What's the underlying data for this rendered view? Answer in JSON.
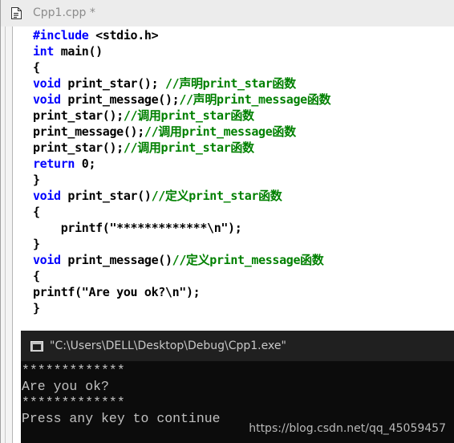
{
  "editor": {
    "tab_title": "Cpp1.cpp *",
    "icon": "cpp-file-icon",
    "lines": [
      {
        "segments": [
          {
            "text": "#include",
            "kind": "kw"
          },
          {
            "text": " <stdio.h>",
            "kind": "tx"
          }
        ]
      },
      {
        "segments": [
          {
            "text": "int",
            "kind": "kw"
          },
          {
            "text": " main()",
            "kind": "tx"
          }
        ]
      },
      {
        "segments": [
          {
            "text": "{",
            "kind": "tx"
          }
        ]
      },
      {
        "segments": [
          {
            "text": "void",
            "kind": "kw"
          },
          {
            "text": " print_star(); ",
            "kind": "tx"
          },
          {
            "text": "//声明print_star函数",
            "kind": "cm"
          }
        ]
      },
      {
        "segments": [
          {
            "text": "void",
            "kind": "kw"
          },
          {
            "text": " print_message();",
            "kind": "tx"
          },
          {
            "text": "//声明print_message函数",
            "kind": "cm"
          }
        ]
      },
      {
        "segments": [
          {
            "text": "print_star();",
            "kind": "tx"
          },
          {
            "text": "//调用print_star函数",
            "kind": "cm"
          }
        ]
      },
      {
        "segments": [
          {
            "text": "print_message();",
            "kind": "tx"
          },
          {
            "text": "//调用print_message函数",
            "kind": "cm"
          }
        ]
      },
      {
        "segments": [
          {
            "text": "print_star();",
            "kind": "tx"
          },
          {
            "text": "//调用print_star函数",
            "kind": "cm"
          }
        ]
      },
      {
        "segments": [
          {
            "text": "return",
            "kind": "kw"
          },
          {
            "text": " 0;",
            "kind": "tx"
          }
        ]
      },
      {
        "segments": [
          {
            "text": "}",
            "kind": "tx"
          }
        ]
      },
      {
        "segments": [
          {
            "text": "void",
            "kind": "kw"
          },
          {
            "text": " print_star()",
            "kind": "tx"
          },
          {
            "text": "//定义print_star函数",
            "kind": "cm"
          }
        ]
      },
      {
        "segments": [
          {
            "text": "{",
            "kind": "tx"
          }
        ]
      },
      {
        "segments": [
          {
            "text": "    printf(\"*************\\n\");",
            "kind": "tx"
          }
        ]
      },
      {
        "segments": [
          {
            "text": "}",
            "kind": "tx"
          }
        ]
      },
      {
        "segments": [
          {
            "text": "void",
            "kind": "kw"
          },
          {
            "text": " print_message()",
            "kind": "tx"
          },
          {
            "text": "//定义print_message函数",
            "kind": "cm"
          }
        ]
      },
      {
        "segments": [
          {
            "text": "{",
            "kind": "tx"
          }
        ]
      },
      {
        "segments": [
          {
            "text": "printf(\"Are you ok?\\n\");",
            "kind": "tx"
          }
        ]
      },
      {
        "segments": [
          {
            "text": "}",
            "kind": "tx"
          }
        ]
      }
    ],
    "colors": {
      "keyword": "#0000ff",
      "comment": "#008000",
      "text": "#000000"
    }
  },
  "console": {
    "title": "\"C:\\Users\\DELL\\Desktop\\Debug\\Cpp1.exe\"",
    "icon": "console-window-icon",
    "output_lines": [
      "*************",
      "Are you ok?",
      "*************",
      "Press any key to continue"
    ]
  },
  "watermark": "https://blog.csdn.net/qq_45059457"
}
